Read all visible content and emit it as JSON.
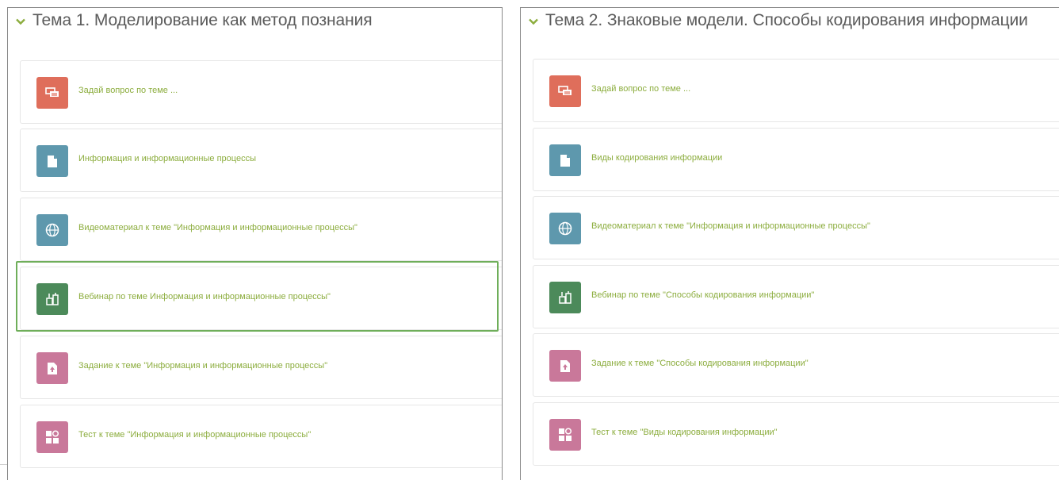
{
  "sections": [
    {
      "title": "Тема 1. Моделирование как метод познания",
      "activities": [
        {
          "label": "Задай вопрос по теме ...",
          "icon": "forum-icon"
        },
        {
          "label": "Информация и информационные процессы",
          "icon": "file-icon"
        },
        {
          "label": "Видеоматериал к теме \"Информация и информационные процессы\"",
          "icon": "globe-icon"
        },
        {
          "label": "Вебинар по теме Информация и информационные процессы\"",
          "icon": "webinar-icon"
        },
        {
          "label": "Задание к теме \"Информация и информационные процессы\"",
          "icon": "assignment-icon"
        },
        {
          "label": "Тест к теме \"Информация и информационные процессы\"",
          "icon": "quiz-icon"
        }
      ]
    },
    {
      "title": "Тема 2. Знаковые модели. Способы кодирования информации",
      "activities": [
        {
          "label": "Задай вопрос по теме ...",
          "icon": "forum-icon"
        },
        {
          "label": "Виды кодирования информации",
          "icon": "file-icon"
        },
        {
          "label": "Видеоматериал к теме \"Информация и информационные процессы\"",
          "icon": "globe-icon"
        },
        {
          "label": "Вебинар по теме \"Способы кодирования информации\"",
          "icon": "webinar-icon"
        },
        {
          "label": "Задание к теме \"Способы кодирования информации\"",
          "icon": "assignment-icon"
        },
        {
          "label": "Тест к теме \"Виды кодирования информации\"",
          "icon": "quiz-icon"
        }
      ]
    }
  ],
  "colors": {
    "link_green": "#8cad3e",
    "forum": "#df6e5b",
    "resource": "#5e98ad",
    "webinar": "#4c8a5a",
    "assignment": "#c9789a",
    "highlight_border": "#6fae5a"
  }
}
